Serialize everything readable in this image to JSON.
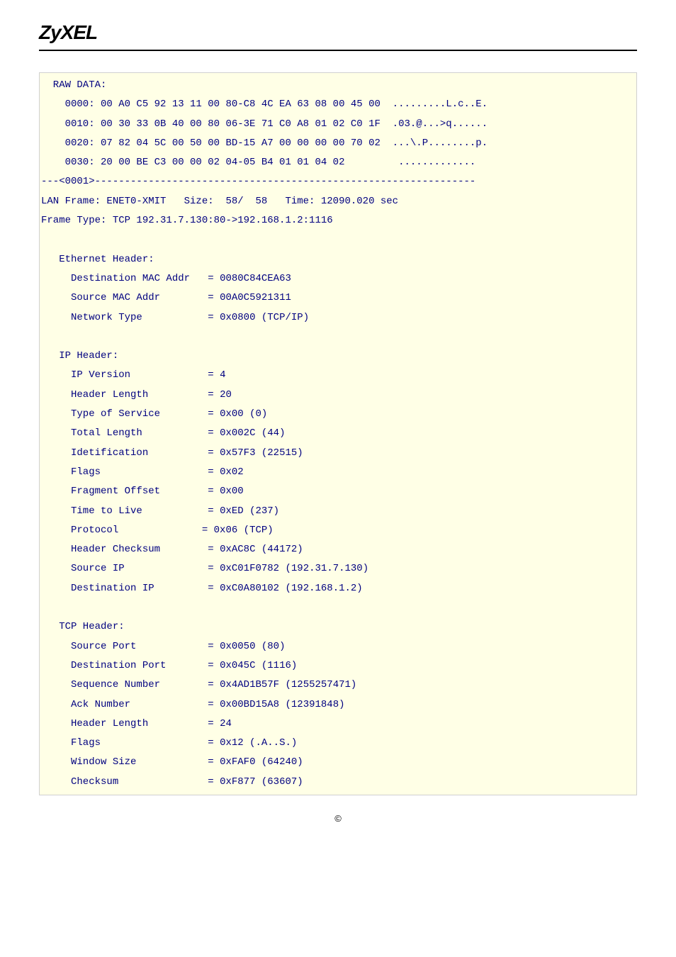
{
  "logo": "ZyXEL",
  "footer_symbol": "©",
  "packet": {
    "raw_data_label": "  RAW DATA:",
    "raw_lines": [
      "    0000: 00 A0 C5 92 13 11 00 80-C8 4C EA 63 08 00 45 00  .........L.c..E.",
      "    0010: 00 30 33 0B 40 00 80 06-3E 71 C0 A8 01 02 C0 1F  .03.@...>q......",
      "    0020: 07 82 04 5C 00 50 00 BD-15 A7 00 00 00 00 70 02  ...\\.P........p.",
      "    0030: 20 00 BE C3 00 00 02 04-05 B4 01 01 04 02         .............   "
    ],
    "divider": "---<0001>----------------------------------------------------------------",
    "frame_line1": "LAN Frame: ENET0-XMIT   Size:  58/  58   Time: 12090.020 sec",
    "frame_line2": "Frame Type: TCP 192.31.7.130:80->192.168.1.2:1116",
    "ethernet": {
      "header": "   Ethernet Header:",
      "rows": [
        [
          "     Destination MAC Addr",
          "= 0080C84CEA63"
        ],
        [
          "     Source MAC Addr     ",
          "= 00A0C5921311"
        ],
        [
          "     Network Type        ",
          "= 0x0800 (TCP/IP)"
        ]
      ]
    },
    "ip": {
      "header": "   IP Header:",
      "rows": [
        [
          "     IP Version          ",
          "= 4"
        ],
        [
          "     Header Length       ",
          "= 20"
        ],
        [
          "     Type of Service     ",
          "= 0x00 (0)"
        ],
        [
          "     Total Length        ",
          "= 0x002C (44)"
        ],
        [
          "     Idetification       ",
          "= 0x57F3 (22515)"
        ],
        [
          "     Flags               ",
          "= 0x02"
        ],
        [
          "     Fragment Offset     ",
          "= 0x00"
        ],
        [
          "     Time to Live        ",
          "= 0xED (237)"
        ],
        [
          "     Protocol           ",
          " = 0x06 (TCP)"
        ],
        [
          "     Header Checksum     ",
          "= 0xAC8C (44172)"
        ],
        [
          "     Source IP           ",
          "= 0xC01F0782 (192.31.7.130)"
        ],
        [
          "     Destination IP      ",
          "= 0xC0A80102 (192.168.1.2)"
        ]
      ]
    },
    "tcp": {
      "header": "   TCP Header:",
      "rows": [
        [
          "     Source Port         ",
          "= 0x0050 (80)"
        ],
        [
          "     Destination Port    ",
          "= 0x045C (1116)"
        ],
        [
          "     Sequence Number     ",
          "= 0x4AD1B57F (1255257471)"
        ],
        [
          "     Ack Number          ",
          "= 0x00BD15A8 (12391848)"
        ],
        [
          "     Header Length       ",
          "= 24"
        ],
        [
          "     Flags               ",
          "= 0x12 (.A..S.)"
        ],
        [
          "     Window Size         ",
          "= 0xFAF0 (64240)"
        ],
        [
          "     Checksum            ",
          "= 0xF877 (63607)"
        ]
      ]
    }
  }
}
